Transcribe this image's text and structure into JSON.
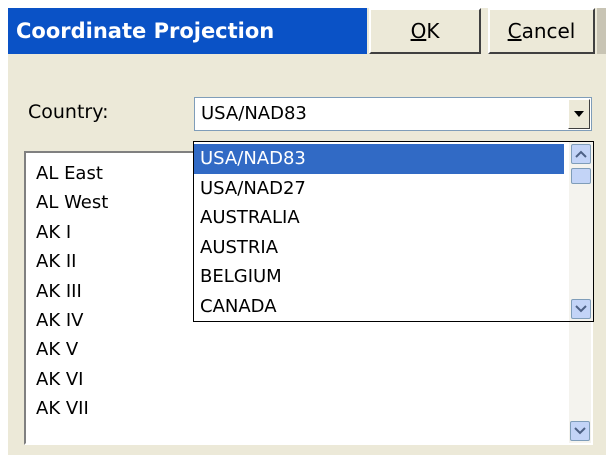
{
  "dialog": {
    "title": "Coordinate Projection",
    "ok_button": {
      "accel": "O",
      "rest": "K"
    },
    "cancel_button": {
      "accel": "C",
      "rest": "ancel"
    }
  },
  "country": {
    "label": "Country:",
    "selected_value": "USA/NAD83",
    "options": [
      "USA/NAD83",
      "USA/NAD27",
      "AUSTRALIA",
      "AUSTRIA",
      "BELGIUM",
      "CANADA"
    ]
  },
  "zone_list": {
    "items": [
      "AL East",
      "AL West",
      "AK I",
      "AK II",
      "AK III",
      "AK IV",
      "AK V",
      "AK VI",
      "AK VII"
    ]
  },
  "icons": {
    "combo_button": "dropdown-arrow-icon",
    "scroll_up": "scroll-up-icon",
    "scroll_down": "scroll-down-icon"
  },
  "colors": {
    "title_bar": "#0a52c6",
    "selection": "#316ac5",
    "dialog_background": "#ece9d8"
  }
}
